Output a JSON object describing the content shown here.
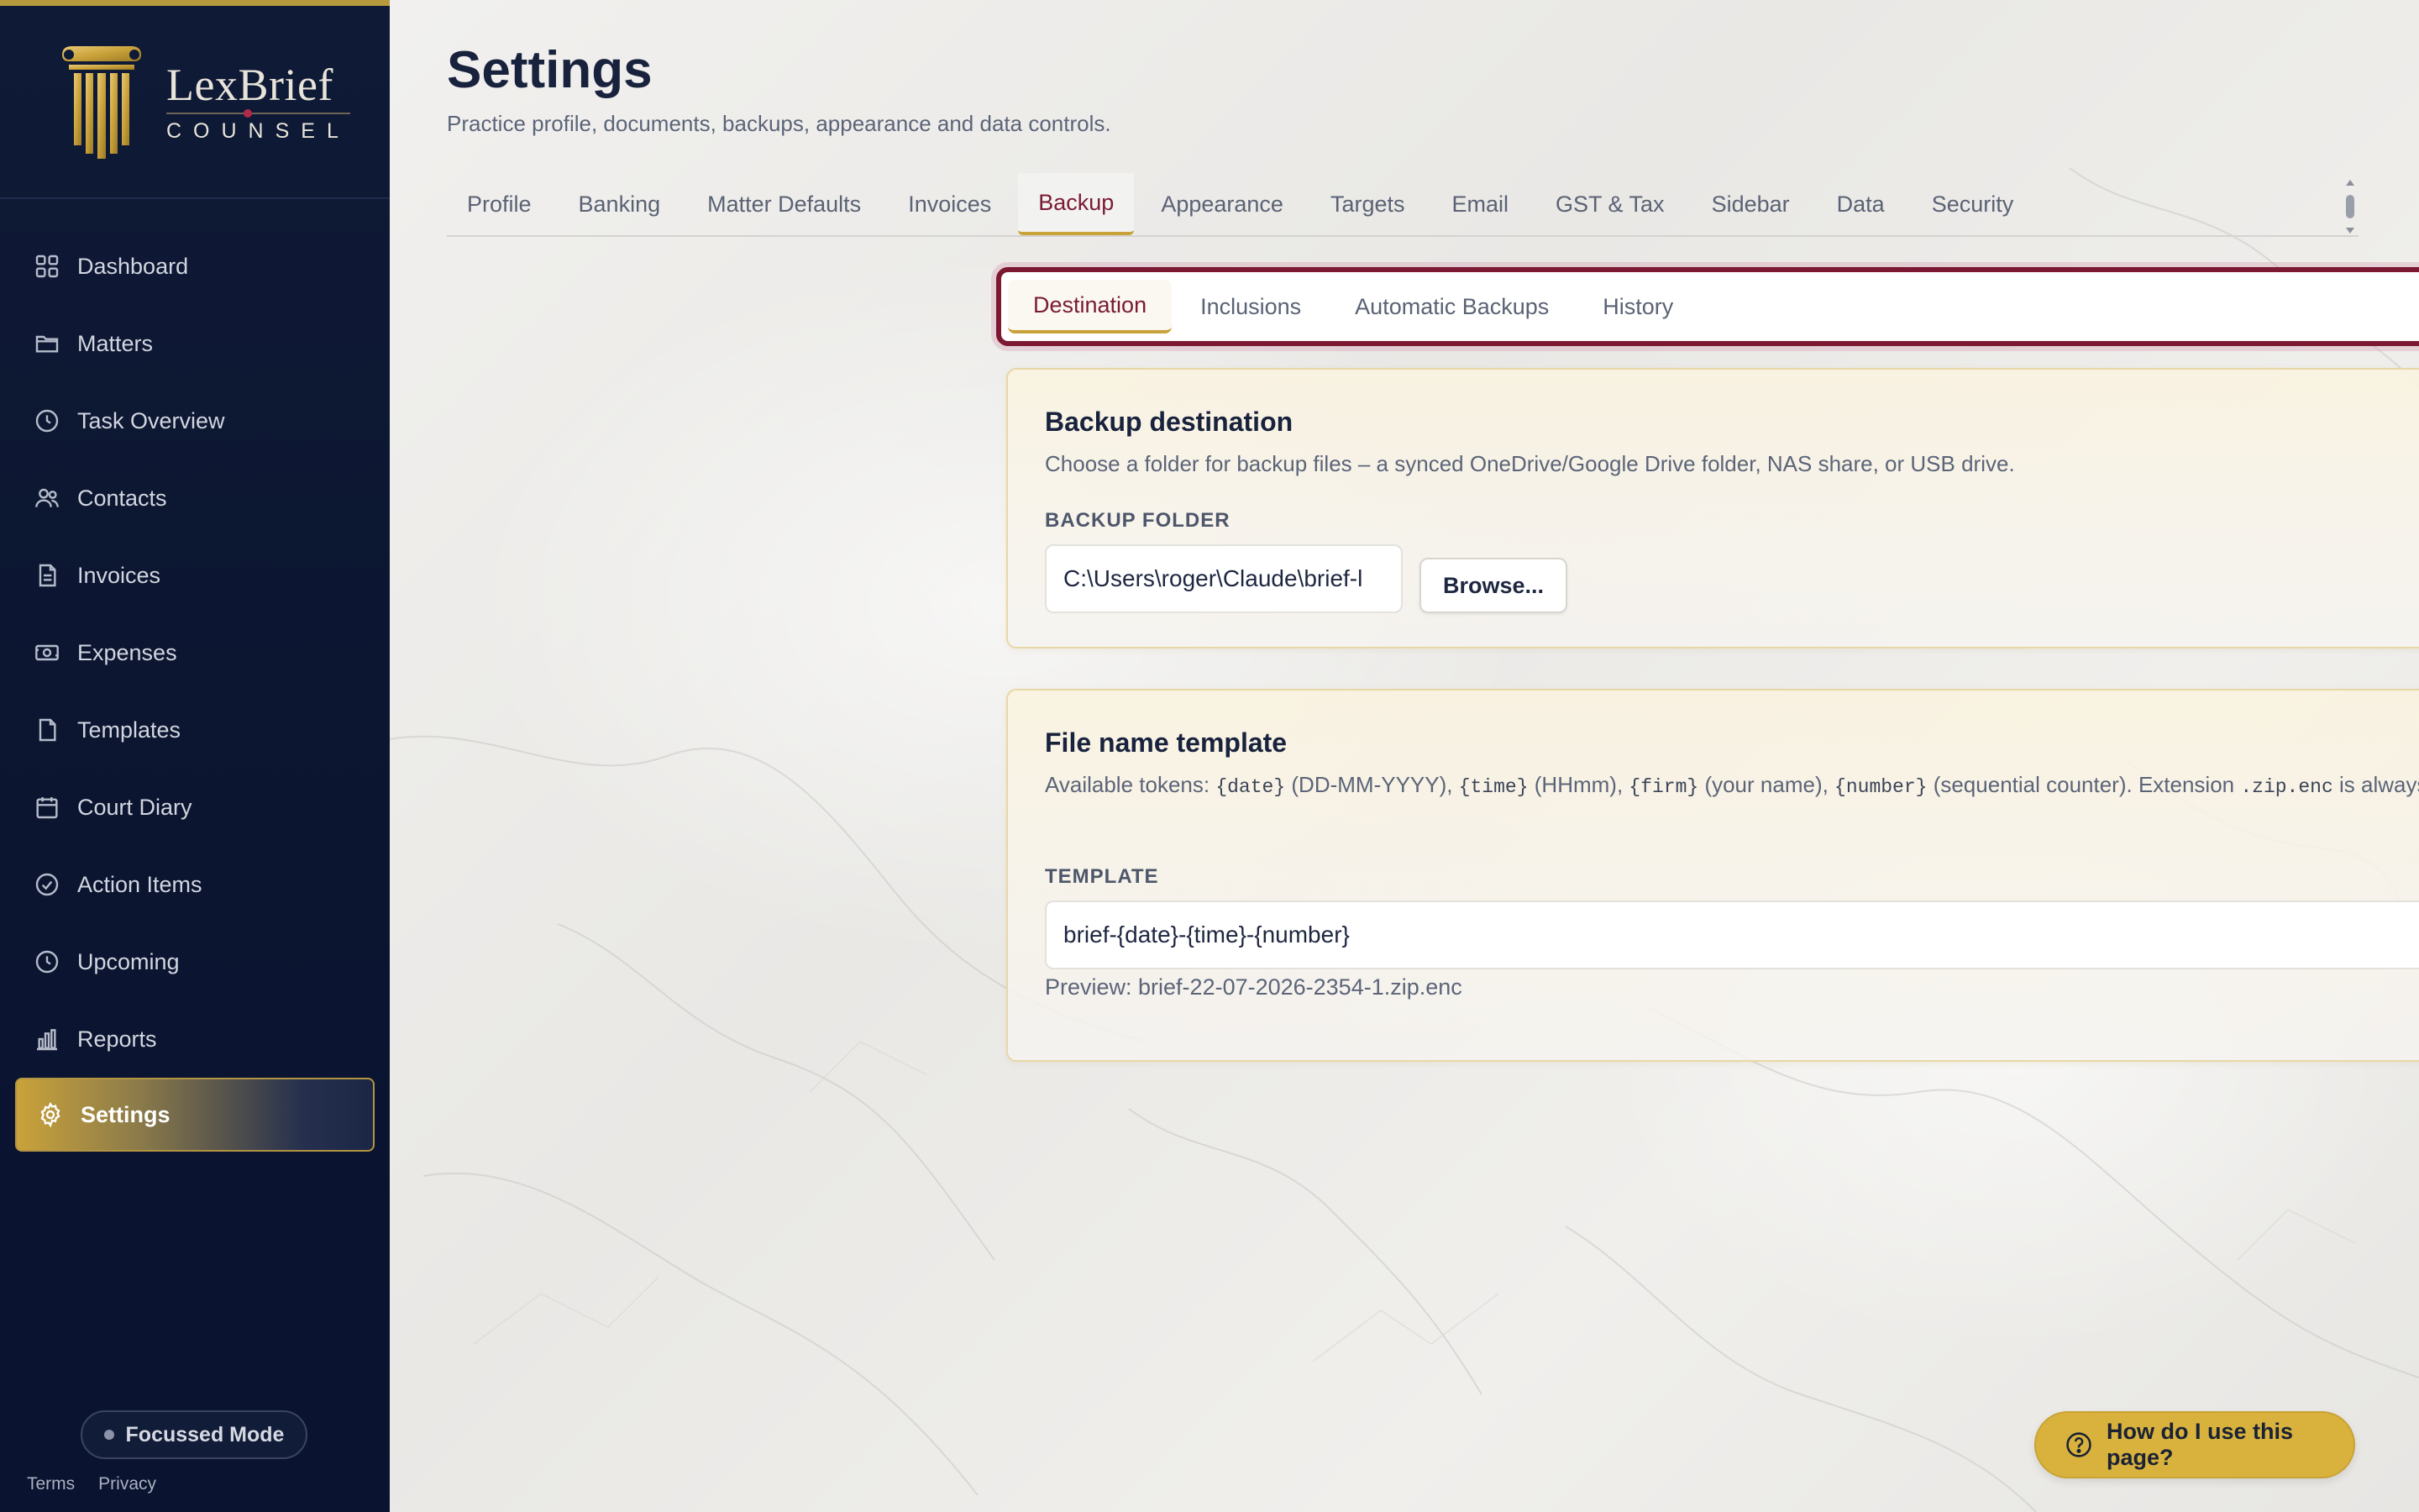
{
  "brand": {
    "name": "LexBrief",
    "sub": "COUNSEL"
  },
  "sidebar": {
    "items": [
      {
        "label": "Dashboard",
        "icon": "grid-icon"
      },
      {
        "label": "Matters",
        "icon": "folder-icon"
      },
      {
        "label": "Task Overview",
        "icon": "clock-icon"
      },
      {
        "label": "Contacts",
        "icon": "users-icon"
      },
      {
        "label": "Invoices",
        "icon": "document-icon"
      },
      {
        "label": "Expenses",
        "icon": "banknote-icon"
      },
      {
        "label": "Templates",
        "icon": "file-icon"
      },
      {
        "label": "Court Diary",
        "icon": "calendar-icon"
      },
      {
        "label": "Action Items",
        "icon": "check-circle-icon"
      },
      {
        "label": "Upcoming",
        "icon": "clock-icon"
      },
      {
        "label": "Reports",
        "icon": "bar-chart-icon"
      },
      {
        "label": "Settings",
        "icon": "gear-icon",
        "active": true
      }
    ],
    "focus_mode": "Focussed Mode",
    "footer": {
      "terms": "Terms",
      "privacy": "Privacy"
    }
  },
  "header": {
    "title": "Settings",
    "subtitle": "Practice profile, documents, backups, appearance and data controls."
  },
  "tabs": [
    "Profile",
    "Banking",
    "Matter Defaults",
    "Invoices",
    "Backup",
    "Appearance",
    "Targets",
    "Email",
    "GST & Tax",
    "Sidebar",
    "Data",
    "Security"
  ],
  "active_tab": "Backup",
  "subtabs": [
    "Destination",
    "Inclusions",
    "Automatic Backups",
    "History"
  ],
  "active_subtab": "Destination",
  "destination_card": {
    "title": "Backup destination",
    "description": "Choose a folder for backup files – a synced OneDrive/Google Drive folder, NAS share, or USB drive.",
    "field_label": "BACKUP FOLDER",
    "folder_value": "C:\\Users\\roger\\Claude\\brief-l",
    "browse_label": "Browse..."
  },
  "filename_card": {
    "title": "File name template",
    "desc_parts": {
      "p1": "Available tokens: ",
      "t1": "{date}",
      "p2": " (DD-MM-YYYY), ",
      "t2": "{time}",
      "p3": " (HHmm), ",
      "t3": "{firm}",
      "p4": " (your name), ",
      "t4": "{number}",
      "p5": " (sequential counter). Extension ",
      "t5": ".zip.enc",
      "p6": " is always appended."
    },
    "field_label": "TEMPLATE",
    "template_value": "brief-{date}-{time}-{number}",
    "preview": "Preview: brief-22-07-2026-2354-1.zip.enc"
  },
  "help_button": "How do I use this page?",
  "colors": {
    "sidebar_bg": "#0f1a36",
    "accent_gold": "#c9a23a",
    "accent_maroon": "#7c1832",
    "help_bg": "#d9b23d"
  }
}
